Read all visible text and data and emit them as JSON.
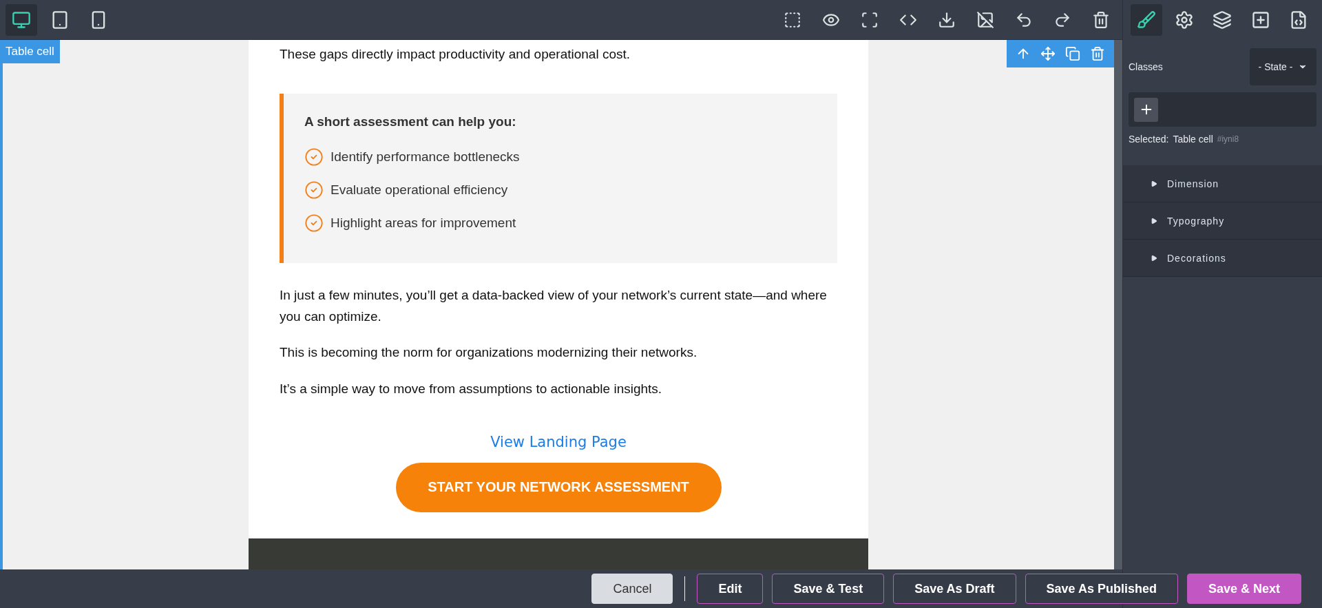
{
  "device_buttons": [
    {
      "kind": "desktop",
      "selected": true
    },
    {
      "kind": "tablet",
      "selected": false
    },
    {
      "kind": "mobile",
      "selected": false
    }
  ],
  "canvas_tools": [
    {
      "kind": "outline"
    },
    {
      "kind": "preview"
    },
    {
      "kind": "fullscreen"
    },
    {
      "kind": "code"
    },
    {
      "kind": "download"
    },
    {
      "kind": "clear-images"
    },
    {
      "kind": "undo"
    },
    {
      "kind": "redo"
    },
    {
      "kind": "delete"
    }
  ],
  "panel_tabs": [
    {
      "kind": "style",
      "selected": true
    },
    {
      "kind": "settings",
      "selected": false
    },
    {
      "kind": "layers",
      "selected": false
    },
    {
      "kind": "blocks",
      "selected": false
    },
    {
      "kind": "code-file",
      "selected": false
    }
  ],
  "selection": {
    "badge": "Table cell",
    "tools": [
      {
        "kind": "select-parent"
      },
      {
        "kind": "move"
      },
      {
        "kind": "duplicate"
      },
      {
        "kind": "delete"
      }
    ]
  },
  "email": {
    "intro": "These gaps directly impact productivity and operational cost.",
    "callout": {
      "title": "A short assessment can help you:",
      "items": [
        "Identify performance bottlenecks",
        "Evaluate operational efficiency",
        "Highlight areas for improvement"
      ]
    },
    "paragraphs": [
      "In just a few minutes, you’ll get a data-backed view of your network’s current state—and where you can optimize.",
      "This is becoming the norm for organizations modernizing their networks.",
      "It’s a simple way to move from assumptions to actionable insights."
    ],
    "link": "View Landing Page",
    "cta": "START YOUR NETWORK ASSESSMENT"
  },
  "style_panel": {
    "classes_label": "Classes",
    "state_select": "- State -",
    "selected_label": "Selected:",
    "selected_name": "Table cell",
    "selected_id": "#iyni8",
    "sections": [
      {
        "label": "Dimension",
        "expanded": false
      },
      {
        "label": "Typography",
        "expanded": false
      },
      {
        "label": "Decorations",
        "expanded": false
      }
    ]
  },
  "footer_buttons": [
    {
      "label": "Cancel",
      "kind": "cancel"
    },
    {
      "label": "Edit",
      "kind": "outline"
    },
    {
      "label": "Save & Test",
      "kind": "outline"
    },
    {
      "label": "Save As Draft",
      "kind": "outline"
    },
    {
      "label": "Save As Published",
      "kind": "outline"
    },
    {
      "label": "Save & Next",
      "kind": "primary"
    }
  ]
}
